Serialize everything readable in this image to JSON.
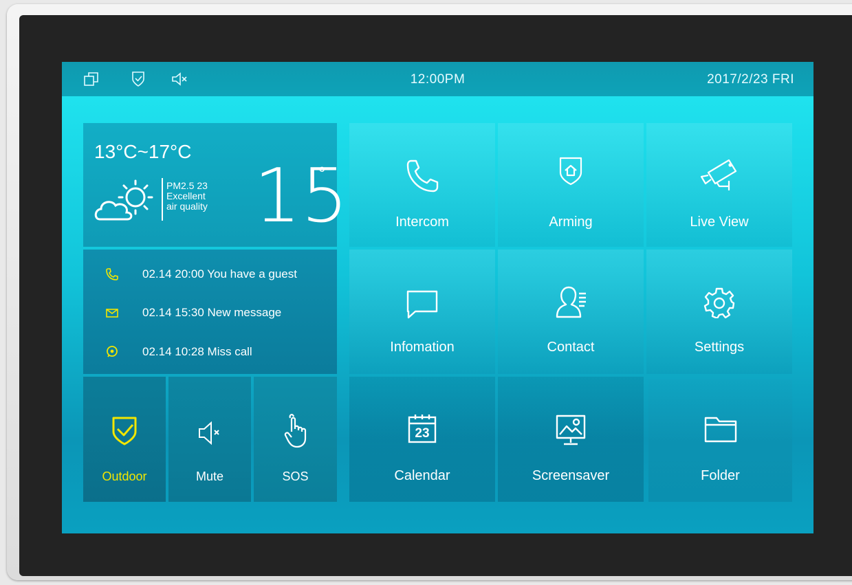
{
  "status_bar": {
    "time": "12:00PM",
    "date": "2017/2/23 FRI",
    "icons": [
      "window-icon",
      "shield-check-icon",
      "speaker-mute-icon"
    ]
  },
  "weather": {
    "range": "13°C~17°C",
    "pm_line1": "PM2.5 23",
    "pm_line2": "Excellent",
    "pm_line3": "air quality",
    "current_temp": "15",
    "degree_symbol": "°",
    "icon": "cloud-sun-icon"
  },
  "notifications": [
    {
      "icon": "phone-icon",
      "text": "02.14  20:00  You have a guest"
    },
    {
      "icon": "envelope-icon",
      "text": "02.14  15:30  New message"
    },
    {
      "icon": "chat-bubble-icon",
      "text": "02.14  10:28  Miss call"
    }
  ],
  "quick": {
    "outdoor": "Outdoor",
    "mute": "Mute",
    "sos": "SOS"
  },
  "apps": {
    "intercom": "Intercom",
    "arming": "Arming",
    "live_view": "Live View",
    "infomation": "Infomation",
    "contact": "Contact",
    "settings": "Settings",
    "calendar": "Calendar",
    "calendar_day": "23",
    "screensaver": "Screensaver",
    "folder": "Folder"
  },
  "colors": {
    "accent_yellow": "#f2e600",
    "screen_top": "#22e8f2",
    "screen_bottom": "#0a96b6"
  }
}
